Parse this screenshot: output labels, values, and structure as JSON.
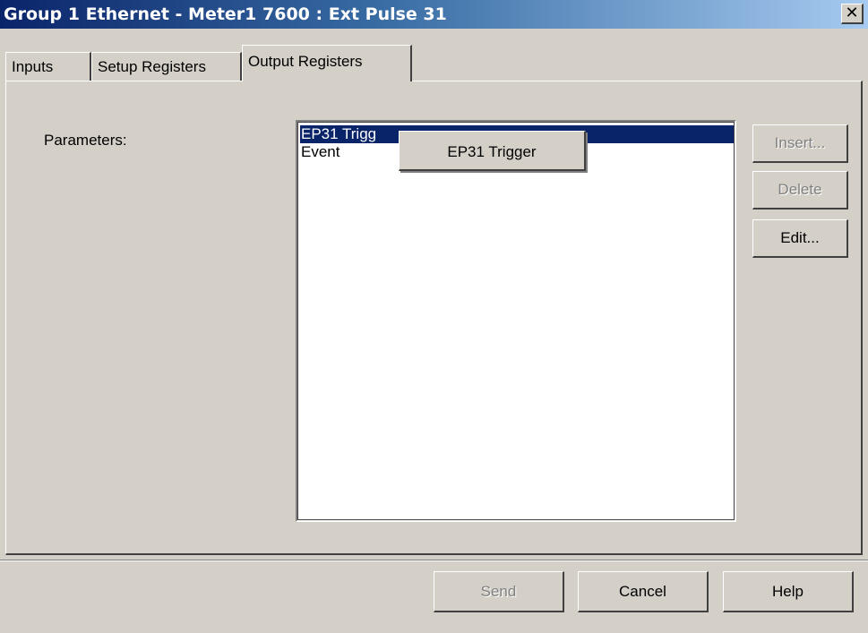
{
  "window": {
    "title": "Group 1 Ethernet - Meter1 7600 : Ext Pulse 31",
    "close_glyph": "✕"
  },
  "tabs": [
    {
      "label": "Inputs",
      "active": false
    },
    {
      "label": "Setup Registers",
      "active": false
    },
    {
      "label": "Output Registers",
      "active": true
    }
  ],
  "parameters": {
    "label": "Parameters:",
    "items": [
      {
        "label": "EP31 Trigg",
        "selected": true
      },
      {
        "label": "Event",
        "selected": false
      }
    ],
    "tooltip": "EP31 Trigger"
  },
  "side_buttons": {
    "insert": "Insert...",
    "delete": "Delete",
    "edit": "Edit..."
  },
  "footer_buttons": {
    "send": "Send",
    "cancel": "Cancel",
    "help": "Help"
  },
  "colors": {
    "selection": "#0a246a",
    "dialog_face": "#d4d0c8",
    "title_gradient_start": "#0a246a",
    "title_gradient_end": "#a6caf0"
  }
}
